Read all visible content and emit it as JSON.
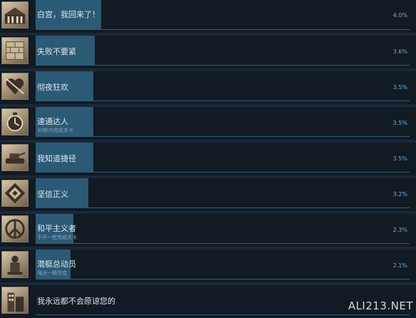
{
  "achievements": [
    {
      "title": "白宫，我回来了！",
      "desc": "",
      "percent": "4.0%",
      "fill": 0.04,
      "icon": "white-house-icon"
    },
    {
      "title": "失败不要紧",
      "desc": "",
      "percent": "3.6%",
      "fill": 0.036,
      "icon": "brick-wall-icon"
    },
    {
      "title": "彻夜狂欢",
      "desc": "",
      "percent": "3.5%",
      "fill": 0.035,
      "icon": "heart-icon"
    },
    {
      "title": "速通达人",
      "desc": "30秒内完成关卡",
      "percent": "3.5%",
      "fill": 0.035,
      "icon": "stopwatch-icon"
    },
    {
      "title": "我知道捷径",
      "desc": "",
      "percent": "3.5%",
      "fill": 0.035,
      "icon": "tank-icon"
    },
    {
      "title": "坚信正义",
      "desc": "",
      "percent": "3.2%",
      "fill": 0.032,
      "icon": "diamond-emblem-icon"
    },
    {
      "title": "和平主义者",
      "desc": "不开一枪完成关卡",
      "percent": "2.3%",
      "fill": 0.023,
      "icon": "peace-sign-icon"
    },
    {
      "title": "潜艇总动员",
      "desc": "淹没一辆坦克",
      "percent": "2.1%",
      "fill": 0.021,
      "icon": "statue-icon"
    },
    {
      "title": "我永远都不会原谅您的",
      "desc": "",
      "percent": "",
      "fill": 0.0,
      "icon": "building-icon"
    }
  ],
  "watermark": "ALI213.NET",
  "colors": {
    "background": "#1b2838",
    "row": "#121a24",
    "progress": "#2b5a75",
    "percent_text": "#66b2e3"
  }
}
